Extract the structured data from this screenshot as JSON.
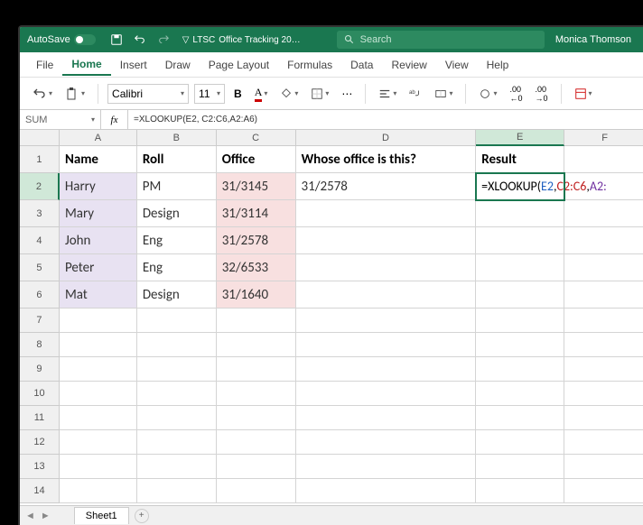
{
  "titlebar": {
    "autosave_label": "AutoSave",
    "doc_prefix": "LTSC",
    "doc_name": "Office Tracking 20…",
    "search_placeholder": "Search",
    "user": "Monica Thomson"
  },
  "tabs": [
    "File",
    "Home",
    "Insert",
    "Draw",
    "Page Layout",
    "Formulas",
    "Data",
    "Review",
    "View",
    "Help"
  ],
  "active_tab": "Home",
  "ribbon": {
    "font_name": "Calibri",
    "font_size": "11",
    "bold": "B",
    "overflow": "⋯"
  },
  "name_box": "SUM",
  "fx": "fx",
  "formula_text": "=XLOOKUP(E2, C2:C6,A2:A6)",
  "active_display": {
    "prefix": "=XLOOKUP(",
    "a1": "E2",
    "c1": ", ",
    "a2": "C2:C6",
    "c2": ",",
    "a3": "A2:"
  },
  "columns": [
    "A",
    "B",
    "C",
    "D",
    "E",
    "F"
  ],
  "row_nums": [
    "1",
    "2",
    "3",
    "4",
    "5",
    "6",
    "7",
    "8",
    "9",
    "10",
    "11",
    "12",
    "13",
    "14"
  ],
  "headers": {
    "A": "Name",
    "B": "Roll",
    "C": "Office",
    "D": "Whose office is this?",
    "E": "Result"
  },
  "data": {
    "r2": {
      "A": "Harry",
      "B": "PM",
      "C": "31/3145",
      "D": "31/2578"
    },
    "r3": {
      "A": "Mary",
      "B": "Design",
      "C": "31/3114"
    },
    "r4": {
      "A": "John",
      "B": "Eng",
      "C": "31/2578"
    },
    "r5": {
      "A": "Peter",
      "B": "Eng",
      "C": "32/6533"
    },
    "r6": {
      "A": "Mat",
      "B": "Design",
      "C": "31/1640"
    }
  },
  "sheet": {
    "name": "Sheet1"
  }
}
